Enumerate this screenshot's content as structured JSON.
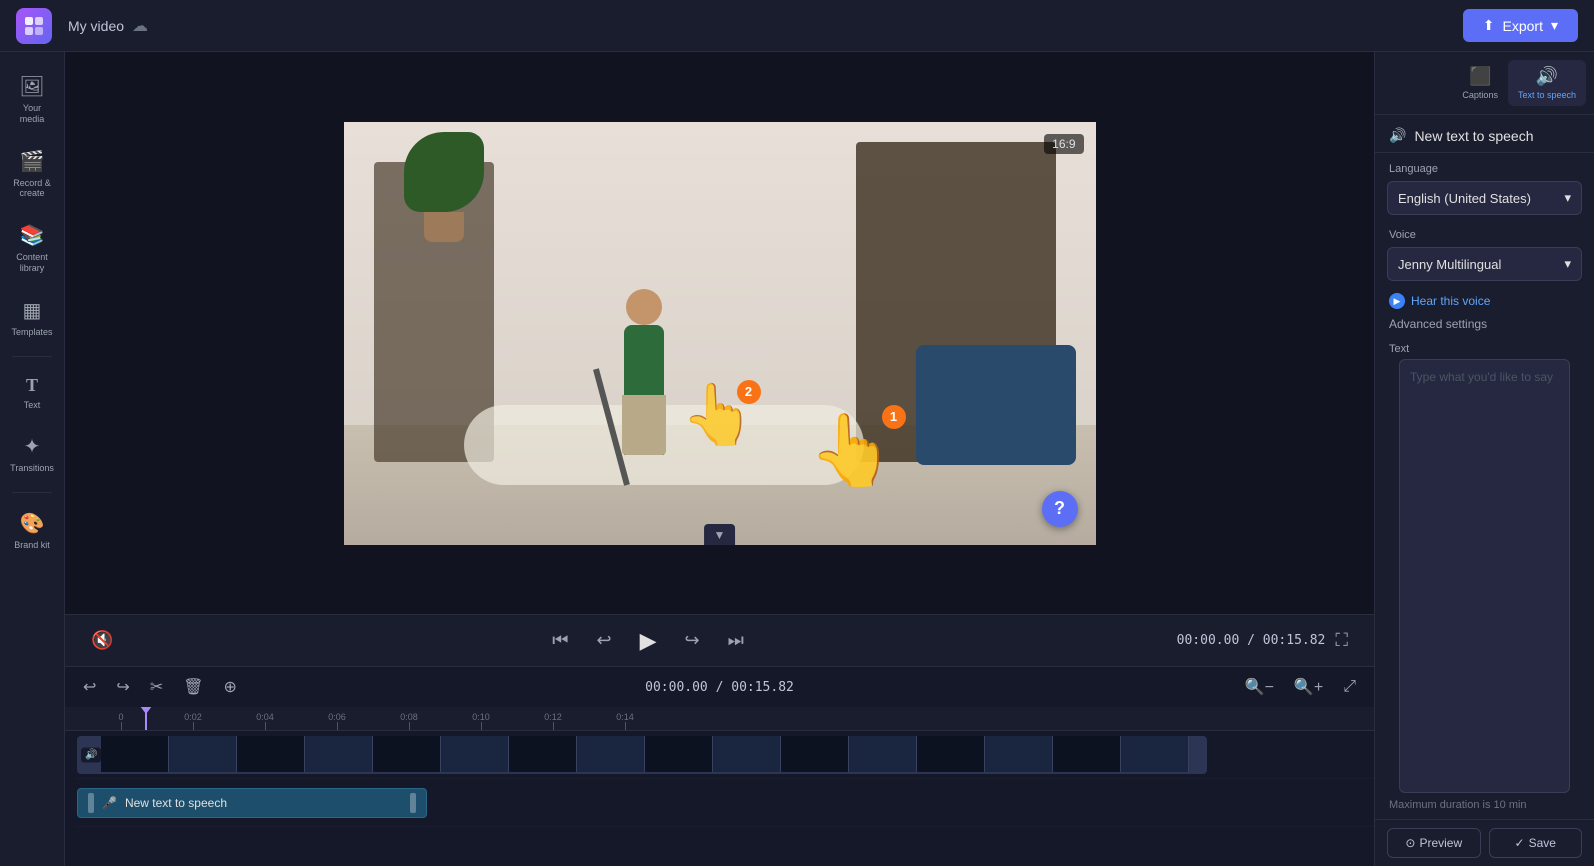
{
  "topbar": {
    "project_name": "My video",
    "export_label": "Export",
    "cloud_title": "Save to cloud"
  },
  "sidebar": {
    "items": [
      {
        "id": "your-media",
        "icon": "🖼",
        "label": "Your media"
      },
      {
        "id": "record-create",
        "icon": "🎬",
        "label": "Record & create"
      },
      {
        "id": "content-library",
        "icon": "📚",
        "label": "Content library"
      },
      {
        "id": "templates",
        "icon": "▦",
        "label": "Templates"
      },
      {
        "id": "text",
        "icon": "T",
        "label": "Text"
      },
      {
        "id": "transitions",
        "icon": "✦",
        "label": "Transitions"
      },
      {
        "id": "brand-kit",
        "icon": "🎨",
        "label": "Brand kit"
      }
    ]
  },
  "video_preview": {
    "aspect_ratio": "16:9"
  },
  "playback": {
    "current_time": "00:00.00",
    "total_time": "00:15.82",
    "separator": "/"
  },
  "timeline": {
    "toolbar_buttons": [
      "undo",
      "redo",
      "cut",
      "delete",
      "add-media"
    ],
    "zoom_in_label": "+",
    "zoom_out_label": "-",
    "ruler_marks": [
      "0:00",
      "0:02",
      "0:04",
      "0:06",
      "0:08",
      "0:10",
      "0:12",
      "0:14"
    ],
    "tts_track_label": "New text to speech"
  },
  "right_panel": {
    "captions_label": "Captions",
    "tts_panel": {
      "title": "New text to speech",
      "tts_icon_label": "Text to speech",
      "language_section": "Language",
      "language_value": "English (United States)",
      "voice_section": "Voice",
      "voice_value": "Jenny Multilingual",
      "hear_this_voice_label": "Hear this voice",
      "advanced_settings_label": "Advanced settings",
      "text_section": "Text",
      "text_placeholder": "Type what you'd like to say",
      "max_duration_note": "Maximum duration is 10 min",
      "preview_label": "Preview",
      "save_label": "Save"
    }
  },
  "cursors": {
    "hand1_badge": "1",
    "hand2_badge": "2"
  },
  "help_badge": "?",
  "collapse_arrow": "▲"
}
